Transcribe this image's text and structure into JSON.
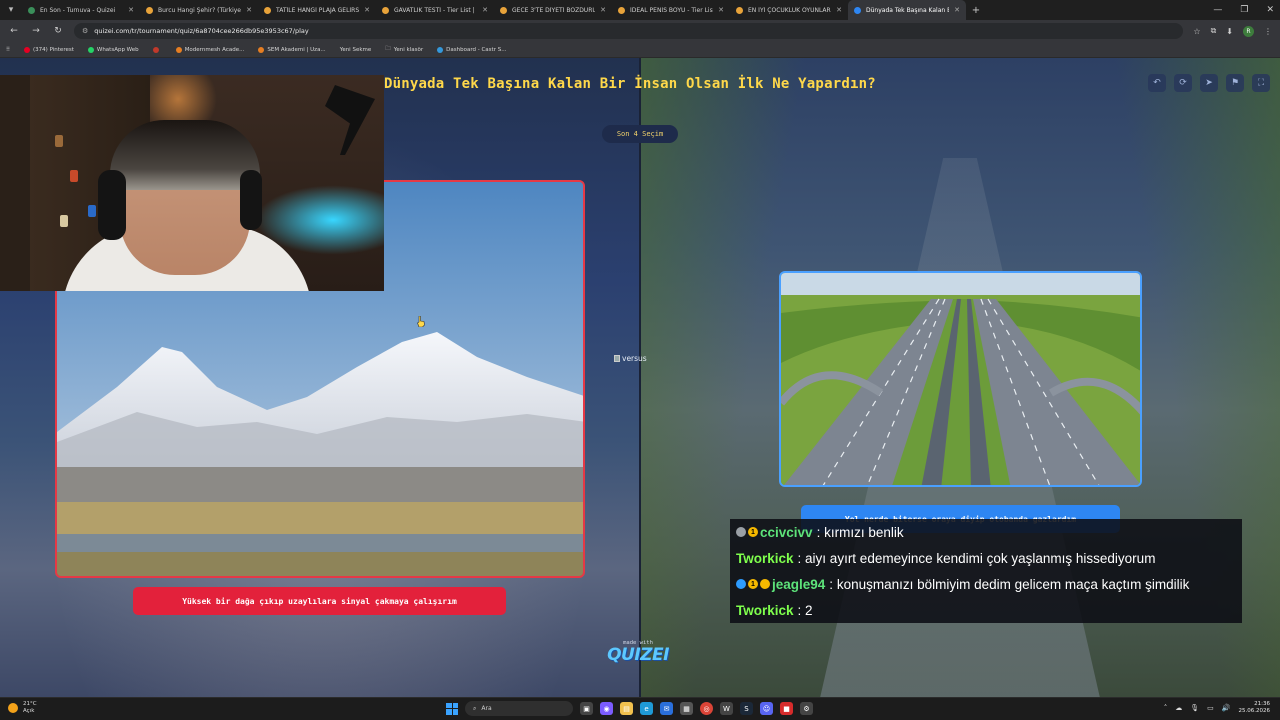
{
  "browser": {
    "tabs": [
      {
        "label": "En Son - Turnuva - Quizei",
        "active": false
      },
      {
        "label": "Burcu Hangi Şehir? (Türkiye)",
        "active": false
      },
      {
        "label": "TATİLE HANGİ PLAJA GELİRSİN",
        "active": false
      },
      {
        "label": "GAVATLIK TESTİ - Tier List | Kor",
        "active": false
      },
      {
        "label": "GECE 3'TE DİYETİ BOZDURUCAK",
        "active": false
      },
      {
        "label": "İDEAL PENİS BOYU - Tier List | ",
        "active": false
      },
      {
        "label": "EN İYİ ÇOCUKLUK OYUNLARI",
        "active": false
      },
      {
        "label": "Dünyada Tek Başına Kalan Bir İ",
        "active": true
      }
    ],
    "url": "quizei.com/tr/tournament/quiz/6a8704cee266db95e3953c67/play",
    "bookmarks": [
      "(374) Pinterest",
      "WhatsApp Web",
      "",
      "Modernmesh Acade...",
      "SEM Akademi | Uza...",
      "Yeni Sekme",
      "Yeni klasör",
      "Dashboard - Castr S..."
    ],
    "profile_initial": "R"
  },
  "quiz": {
    "title": "Dünyada Tek Başına Kalan Bir İnsan Olsan İlk Ne Yapardın?",
    "round": "Son 4 Seçim",
    "versus_alt": "versus",
    "left_option": "Yüksek bir dağa çıkıp uzaylılara sinyal çakmaya çalışırım",
    "right_option": "Yol nerde biterse oraya diyip otobanda gazlardım",
    "made_with": "made with",
    "brand": "QUIZEI"
  },
  "chat": [
    {
      "user": "ccivcivv",
      "color": "#5de37a",
      "message": "kırmızı benlik",
      "badges": [
        "#9aa0a6",
        "#f5b800"
      ]
    },
    {
      "user": "Tworkick",
      "color": "#7fff4d",
      "message": "aiyı ayırt edemeyince kendimi çok yaşlanmış hissediyorum",
      "badges": []
    },
    {
      "user": "jeagle94",
      "color": "#5de37a",
      "message": "konuşmanızı bölmiyim dedim gelicem maça kaçtım şimdilik",
      "badges": [
        "#2d9cff",
        "#f5b800",
        "#f5b800"
      ]
    },
    {
      "user": "Tworkick",
      "color": "#7fff4d",
      "message": "2",
      "badges": []
    }
  ],
  "taskbar": {
    "weather_temp": "21°C",
    "weather_desc": "Açık",
    "search_placeholder": "Ara",
    "time": "21:36",
    "date": "25.06.2026"
  },
  "colors": {
    "left_accent": "#e3213b",
    "right_accent": "#2e86f2",
    "title_yellow": "#ffd84a"
  }
}
